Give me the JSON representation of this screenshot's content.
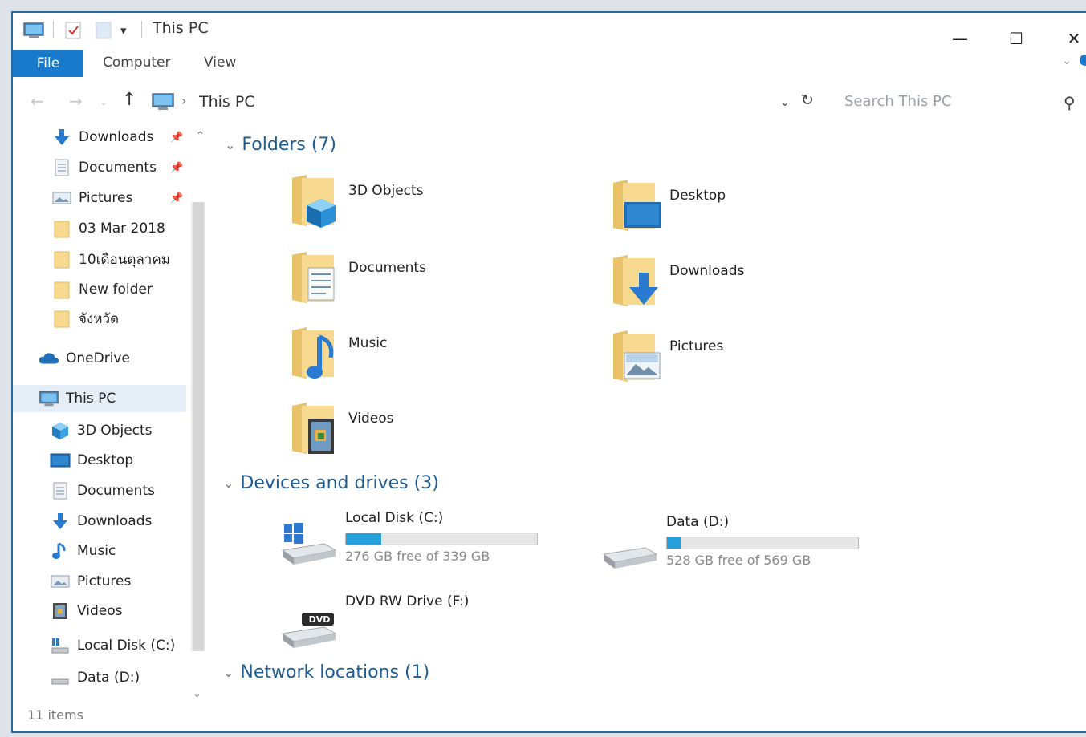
{
  "window": {
    "title": "This PC",
    "minimize_glyph": "—",
    "maximize_glyph": "☐",
    "close_glyph": "✕"
  },
  "ribbon": {
    "file_tab": "File",
    "tabs": [
      "Computer",
      "View"
    ]
  },
  "address": {
    "crumb": "This PC",
    "search_placeholder": "Search This PC"
  },
  "nav": {
    "quick_access": [
      {
        "label": "Downloads",
        "icon": "download-arrow-icon",
        "pinned": true
      },
      {
        "label": "Documents",
        "icon": "document-icon",
        "pinned": true
      },
      {
        "label": "Pictures",
        "icon": "pictures-icon",
        "pinned": true
      },
      {
        "label": "03 Mar 2018",
        "icon": "folder-icon",
        "pinned": false
      },
      {
        "label": "10เดือนตุลาคม",
        "icon": "folder-icon",
        "pinned": false
      },
      {
        "label": "New folder",
        "icon": "folder-icon",
        "pinned": false
      },
      {
        "label": "จังหวัด",
        "icon": "folder-icon",
        "pinned": false
      }
    ],
    "onedrive": "OneDrive",
    "this_pc": "This PC",
    "this_pc_children": [
      {
        "label": "3D Objects",
        "icon": "3d-objects-icon"
      },
      {
        "label": "Desktop",
        "icon": "desktop-icon"
      },
      {
        "label": "Documents",
        "icon": "document-icon"
      },
      {
        "label": "Downloads",
        "icon": "download-arrow-icon"
      },
      {
        "label": "Music",
        "icon": "music-note-icon"
      },
      {
        "label": "Pictures",
        "icon": "pictures-icon"
      },
      {
        "label": "Videos",
        "icon": "videos-icon"
      },
      {
        "label": "Local Disk (C:)",
        "icon": "local-disk-icon"
      },
      {
        "label": "Data (D:)",
        "icon": "drive-icon"
      }
    ]
  },
  "content": {
    "folders_header": "Folders (7)",
    "folders": [
      {
        "label": "3D Objects",
        "icon": "3d-objects-icon"
      },
      {
        "label": "Desktop",
        "icon": "desktop-icon"
      },
      {
        "label": "Documents",
        "icon": "document-icon"
      },
      {
        "label": "Downloads",
        "icon": "download-arrow-icon"
      },
      {
        "label": "Music",
        "icon": "music-note-icon"
      },
      {
        "label": "Pictures",
        "icon": "pictures-icon"
      },
      {
        "label": "Videos",
        "icon": "videos-icon"
      }
    ],
    "devices_header": "Devices and drives (3)",
    "drives": [
      {
        "label": "Local Disk (C:)",
        "free_text": "276 GB free of 339 GB",
        "used_fraction": 0.186,
        "icon": "windows-drive-icon"
      },
      {
        "label": "Data (D:)",
        "free_text": "528 GB free of 569 GB",
        "used_fraction": 0.072,
        "icon": "drive-icon"
      },
      {
        "label": "DVD RW Drive (F:)",
        "dvd_badge": "DVD",
        "icon": "dvd-drive-icon"
      }
    ],
    "network_header": "Network locations (1)"
  },
  "status_bar": {
    "item_count": "11 items"
  },
  "colors": {
    "accent": "#1979ca",
    "header_text": "#1e5c91",
    "progress": "#26a0da",
    "folder": "#f5d27a"
  }
}
